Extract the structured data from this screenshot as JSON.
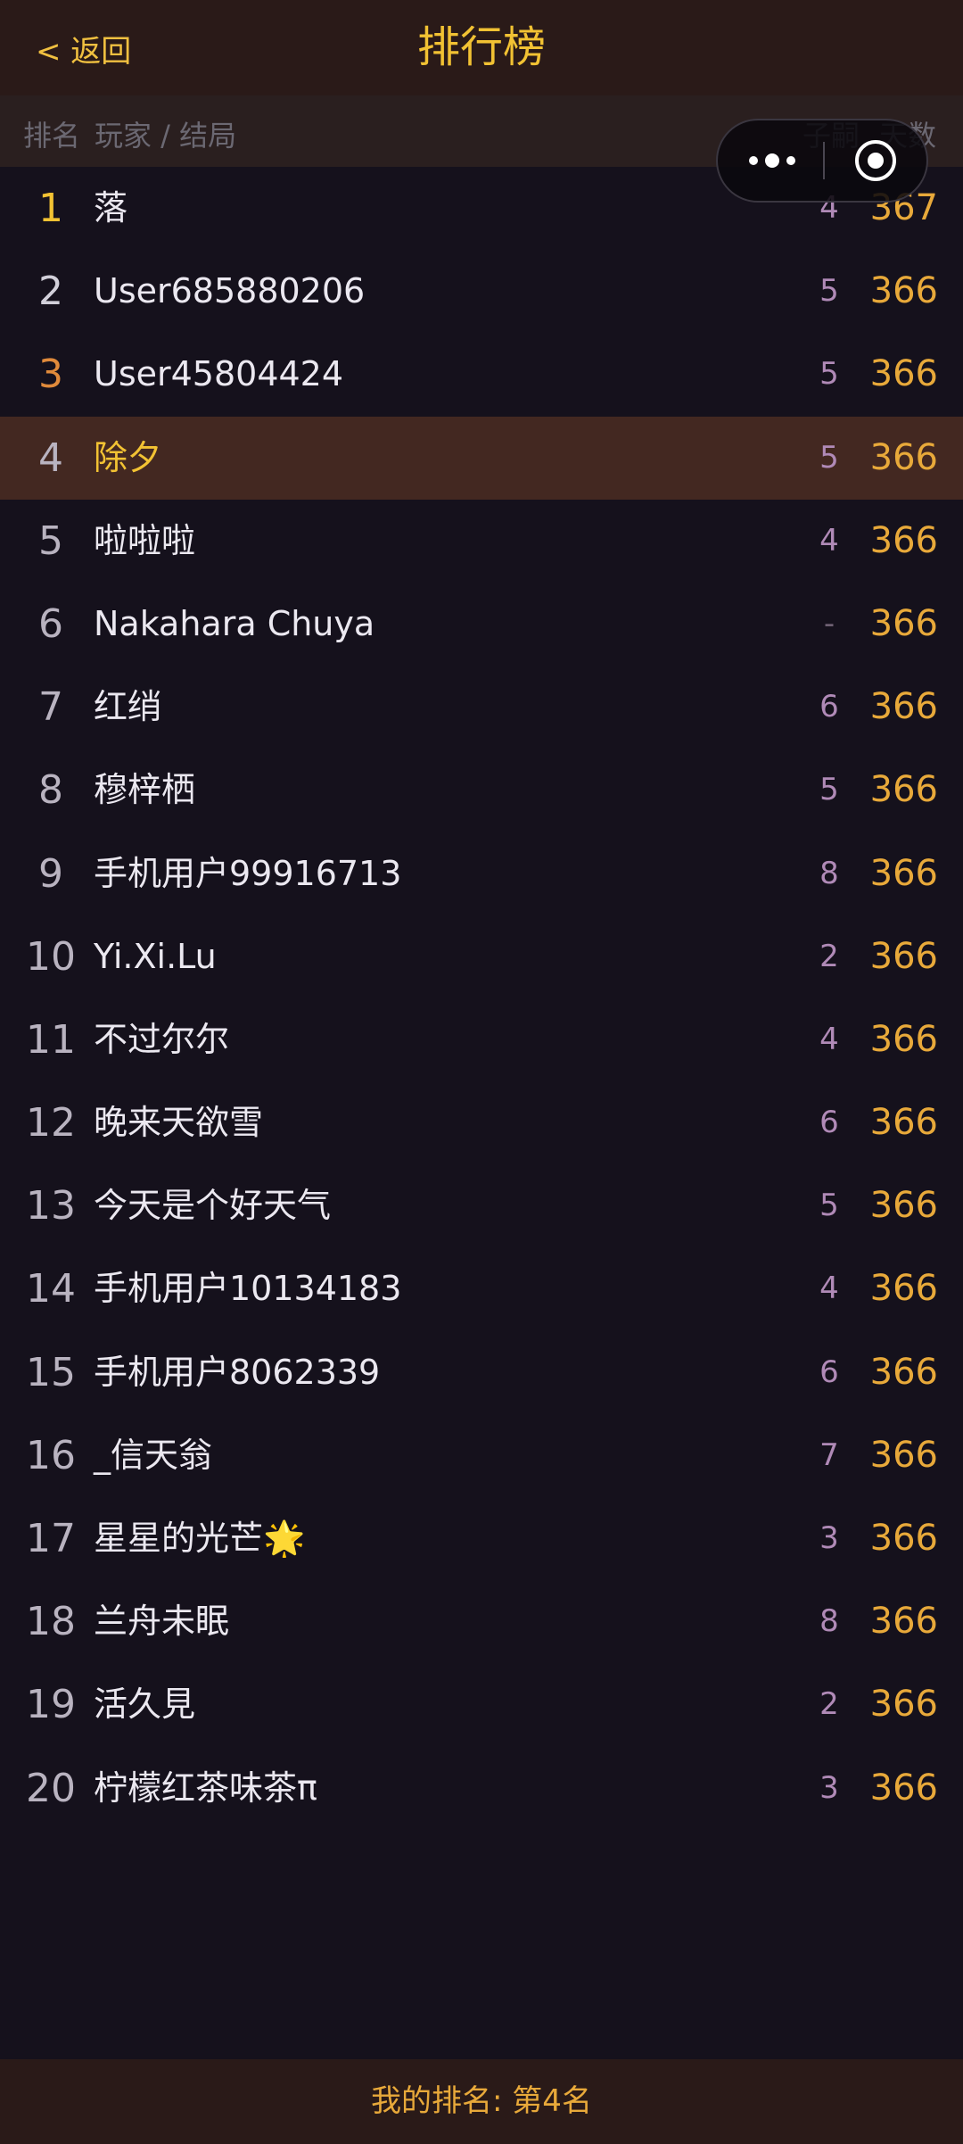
{
  "header": {
    "back_label": "< 返回",
    "title": "排行榜"
  },
  "columns": {
    "rank": "排名",
    "player": "玩家 / 结局",
    "kids": "子嗣",
    "days": "天数"
  },
  "capsule": {
    "more_icon": "more-dots-icon",
    "close_icon": "target-circle-icon"
  },
  "rows": [
    {
      "rank": "1",
      "name": "落",
      "kids": "4",
      "days": "367"
    },
    {
      "rank": "2",
      "name": "User685880206",
      "kids": "5",
      "days": "366"
    },
    {
      "rank": "3",
      "name": "User45804424",
      "kids": "5",
      "days": "366"
    },
    {
      "rank": "4",
      "name": "除夕",
      "kids": "5",
      "days": "366"
    },
    {
      "rank": "5",
      "name": "啦啦啦",
      "kids": "4",
      "days": "366"
    },
    {
      "rank": "6",
      "name": "Nakahara Chuya",
      "kids": "-",
      "days": "366"
    },
    {
      "rank": "7",
      "name": "红绡",
      "kids": "6",
      "days": "366"
    },
    {
      "rank": "8",
      "name": "穆梓栖",
      "kids": "5",
      "days": "366"
    },
    {
      "rank": "9",
      "name": "手机用户99916713",
      "kids": "8",
      "days": "366"
    },
    {
      "rank": "10",
      "name": "Yi.Xi.Lu",
      "kids": "2",
      "days": "366"
    },
    {
      "rank": "11",
      "name": "不过尔尔",
      "kids": "4",
      "days": "366"
    },
    {
      "rank": "12",
      "name": "晚来天欲雪",
      "kids": "6",
      "days": "366"
    },
    {
      "rank": "13",
      "name": "今天是个好天气",
      "kids": "5",
      "days": "366"
    },
    {
      "rank": "14",
      "name": "手机用户10134183",
      "kids": "4",
      "days": "366"
    },
    {
      "rank": "15",
      "name": "手机用户8062339",
      "kids": "6",
      "days": "366"
    },
    {
      "rank": "16",
      "name": "_信天翁",
      "kids": "7",
      "days": "366"
    },
    {
      "rank": "17",
      "name": "星星的光芒🌟",
      "kids": "3",
      "days": "366"
    },
    {
      "rank": "18",
      "name": "兰舟未眠",
      "kids": "8",
      "days": "366"
    },
    {
      "rank": "19",
      "name": "活久見",
      "kids": "2",
      "days": "366"
    },
    {
      "rank": "20",
      "name": "柠檬红茶味茶π",
      "kids": "3",
      "days": "366"
    }
  ],
  "footer": {
    "my_rank": "我的排名: 第4名"
  },
  "colors": {
    "accent_gold": "#f2c233",
    "days_orange": "#e8a93a",
    "kids_purple": "#b08ab7",
    "highlight_row": "#432821",
    "background": "#15111c"
  }
}
